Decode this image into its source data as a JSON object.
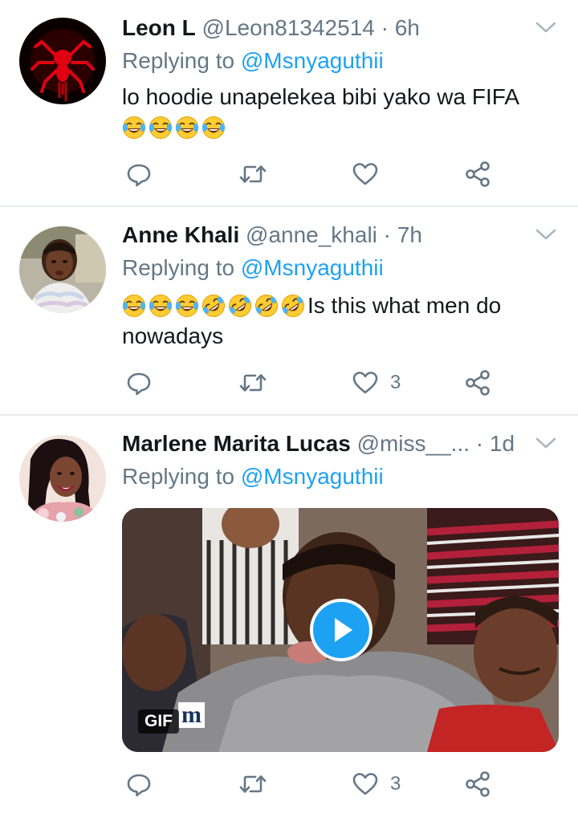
{
  "tweets": [
    {
      "name": "Leon L",
      "handle": "@Leon81342514",
      "time": "· 6h",
      "replying_prefix": "Replying to",
      "replying_to": "@Msnyaguthii",
      "text": "lo hoodie unapelekea bibi yako wa FIFA",
      "emojis": [
        "face-with-tears-of-joy",
        "face-with-tears-of-joy",
        "face-with-tears-of-joy",
        "face-with-tears-of-joy"
      ],
      "like_count": ""
    },
    {
      "name": "Anne Khali",
      "handle": "@anne_khali",
      "time": "· 7h",
      "replying_prefix": "Replying to",
      "replying_to": "@Msnyaguthii",
      "text_after_emojis": "Is this what men do nowadays",
      "emojis": [
        "face-with-tears-of-joy",
        "face-with-tears-of-joy",
        "face-with-tears-of-joy",
        "rolling-on-floor-laughing",
        "rolling-on-floor-laughing",
        "rolling-on-floor-laughing",
        "rolling-on-floor-laughing"
      ],
      "like_count": "3"
    },
    {
      "name": "Marlene Marita Lucas",
      "handle": "@miss__...",
      "time": "· 1d",
      "replying_prefix": "Replying to",
      "replying_to": "@Msnyaguthii",
      "media": {
        "badge": "GIF",
        "watermark": "m",
        "play_icon": "play-icon"
      },
      "like_count": "3"
    }
  ],
  "colors": {
    "accent": "#1da1f2",
    "text": "#14171a",
    "muted": "#657786",
    "divider": "#e6ecf0"
  },
  "icons": [
    "reply-icon",
    "retweet-icon",
    "heart-icon",
    "share-icon",
    "chevron-down-icon"
  ]
}
